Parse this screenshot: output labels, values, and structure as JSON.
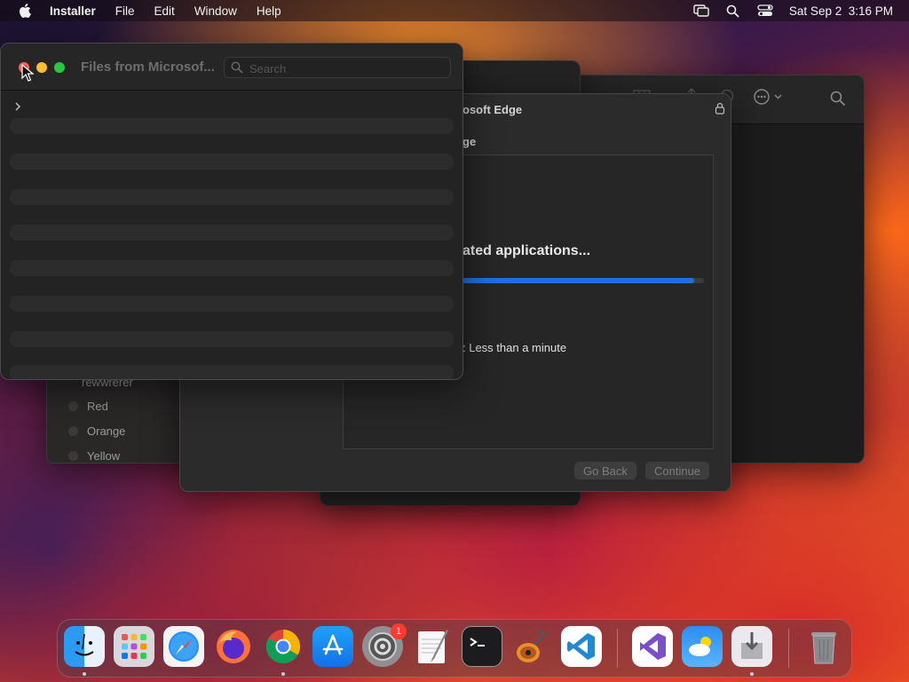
{
  "menubar": {
    "app_name": "Installer",
    "items": [
      "File",
      "Edit",
      "Window",
      "Help"
    ],
    "clock": "Sat Sep 2  3:16 PM"
  },
  "front_window": {
    "title": "Files from Microsof...",
    "search_placeholder": "Search"
  },
  "installer": {
    "title": "osoft Edge",
    "subtitle": "ge",
    "status": "ated applications...",
    "progress": 0.96,
    "time_remaining": ": Less than a minute",
    "go_back_label": "Go Back",
    "continue_label": "Continue",
    "accent": "#1f6fe0"
  },
  "tags_sidebar": {
    "items": [
      "rewwrerer",
      "Red",
      "Orange",
      "Yellow"
    ]
  },
  "dock": {
    "apps": [
      "Finder",
      "Launchpad",
      "Safari",
      "Firefox",
      "Chrome",
      "App Store",
      "System Settings",
      "TextEdit",
      "Terminal",
      "GarageBand",
      "Visual Studio Code",
      "Visual Studio",
      "Weather",
      "Installer",
      "Trash"
    ],
    "settings_badge": "1"
  }
}
